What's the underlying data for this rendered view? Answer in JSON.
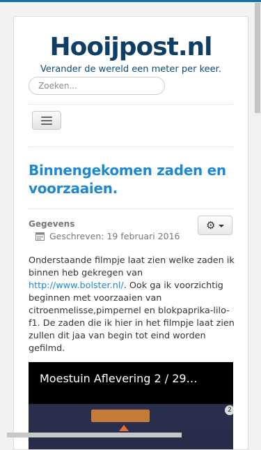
{
  "header": {
    "site_title": "Hooijpost.nl",
    "tagline": "Verander de wereld een meter per keer."
  },
  "search": {
    "placeholder": "Zoeken..."
  },
  "nav": {
    "menu_icon": "hamburger-icon"
  },
  "article": {
    "title": "Binnengekomen zaden en voorzaaien.",
    "details_label": "Gegevens",
    "date_prefix": "Geschreven:",
    "date": "19 februari 2016",
    "body_part1": "Onderstaande filmpje laat zien welke zaden ik binnen heb gekregen van ",
    "link_text": "http://www.bolster.nl/",
    "body_part2": ". Ook ga ik voorzichtig beginnen met voorzaaien van citroenmelisse,pimpernel en blokpaprika-lilo-f1. De zaden die ik hier in het filmpje laat zien zullen dit jaa van begin tot eind worden gefilmd."
  },
  "tools": {
    "icon": "gear-icon"
  },
  "video": {
    "title": "Moestuin Aflevering 2 / 29…",
    "badge": "2"
  },
  "colors": {
    "brand": "#0e3d66",
    "accent": "#1e88d3",
    "topbar": "#0f6fb1"
  }
}
